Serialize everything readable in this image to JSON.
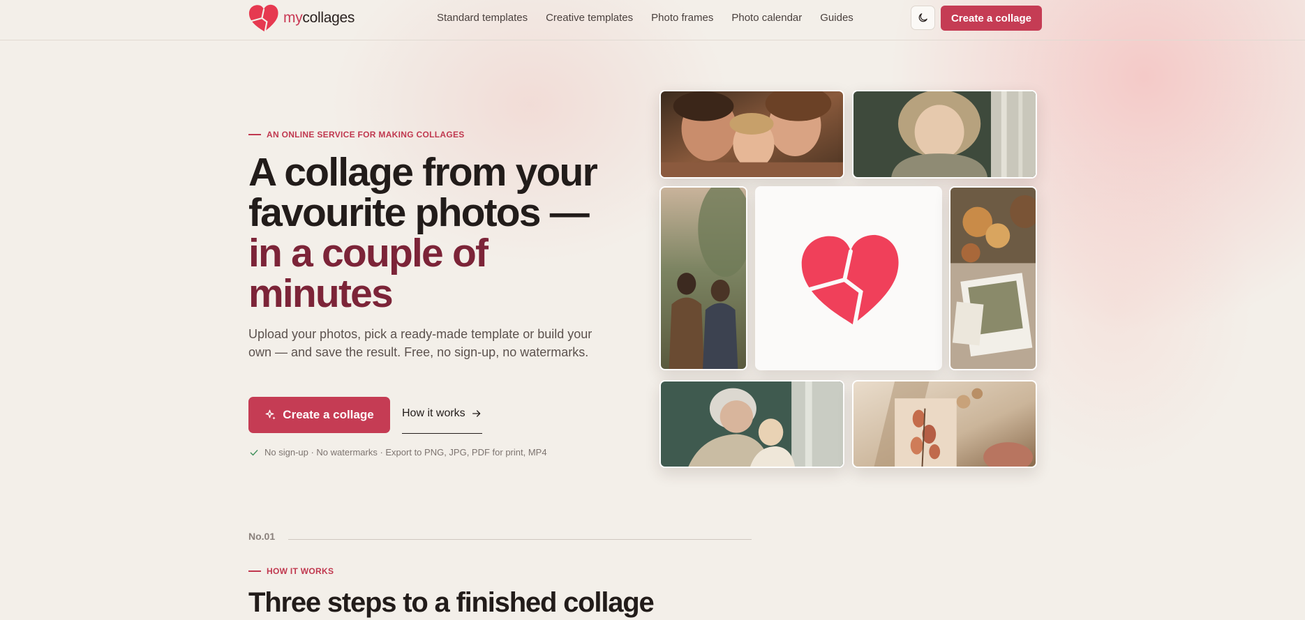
{
  "brand": {
    "logo_prefix": "my",
    "logo_suffix": "collages",
    "accent_color": "#c53c54",
    "headline_accent_color": "#7c2438"
  },
  "nav": {
    "items": [
      {
        "label": "Standard templates"
      },
      {
        "label": "Creative templates"
      },
      {
        "label": "Photo frames"
      },
      {
        "label": "Photo calendar"
      },
      {
        "label": "Guides"
      }
    ],
    "theme_toggle_icon": "moon-icon",
    "cta_label": "Create a collage"
  },
  "hero": {
    "eyebrow": "AN ONLINE SERVICE FOR MAKING COLLAGES",
    "title_plain": "A collage from your favourite photos — ",
    "title_highlight": "in a couple of minutes",
    "description": "Upload your photos, pick a ready-made template or build your own — and save the result. Free, no sign-up, no watermarks.",
    "primary_cta": "Create a collage",
    "primary_cta_icon": "sparkle-icon",
    "secondary_cta": "How it works",
    "secondary_cta_icon": "arrow-right-icon",
    "perks": "No sign-up · No watermarks · Export to PNG, JPG, PDF for print, MP4",
    "perks_icon": "check-icon"
  },
  "collage": {
    "tiles": [
      {
        "name": "family-kiss-photo"
      },
      {
        "name": "curly-child-photo"
      },
      {
        "name": "couple-walking-photo"
      },
      {
        "name": "heart-logo-tile"
      },
      {
        "name": "dried-flowers-polaroid-photo"
      },
      {
        "name": "grandmother-child-photo"
      },
      {
        "name": "dried-branch-photo"
      }
    ]
  },
  "how_it_works": {
    "number": "No.01",
    "eyebrow": "HOW IT WORKS",
    "title": "Three steps to a finished collage"
  }
}
